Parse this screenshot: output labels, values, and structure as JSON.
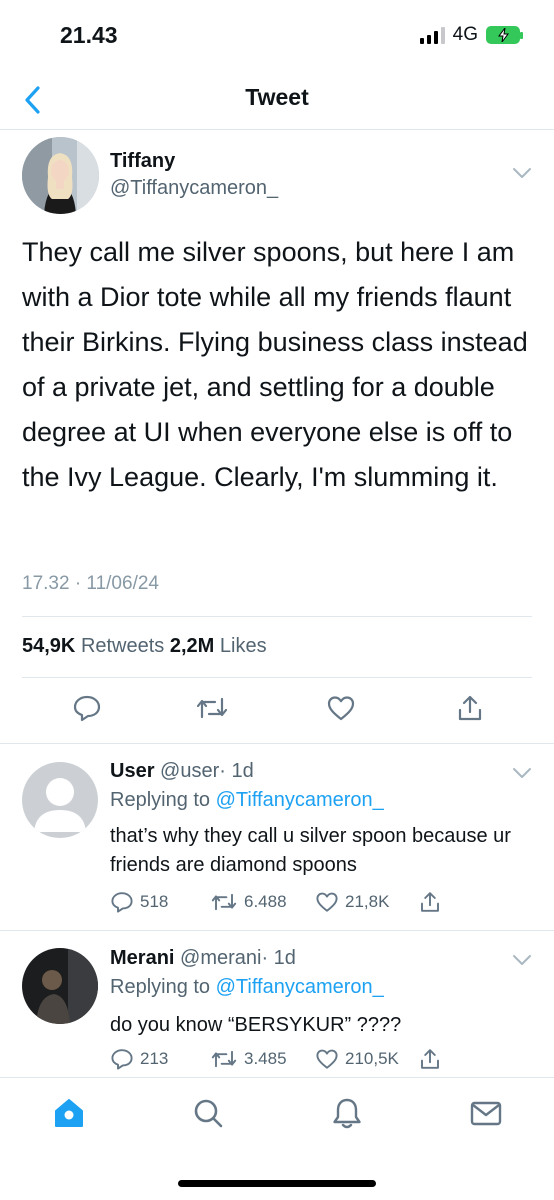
{
  "status_bar": {
    "time": "21.43",
    "network": "4G"
  },
  "header": {
    "title": "Tweet"
  },
  "tweet": {
    "author_name": "Tiffany",
    "author_handle": "@Tiffanycameron_",
    "text": "They call me silver spoons, but here I am with a Dior tote while all my friends flaunt their Birkins. Flying business class instead of a private jet, and settling for a double degree at UI when everyone else is off to the Ivy League. Clearly, I'm slumming it.",
    "timestamp": "17.32 · 11/06/24",
    "retweets_count": "54,9K",
    "retweets_label": "Retweets",
    "likes_count": "2,2M",
    "likes_label": "Likes"
  },
  "replies": [
    {
      "name": "User",
      "handle": "@user",
      "time": "· 1d",
      "replying_prefix": "Replying to",
      "replying_handle": "@Tiffanycameron_",
      "text": "that’s why they call u silver spoon because ur friends are diamond spoons",
      "comments": "518",
      "retweets": "6.488",
      "likes": "21,8K"
    },
    {
      "name": "Merani",
      "handle": "@merani",
      "time": "· 1d",
      "replying_prefix": "Replying to",
      "replying_handle": "@Tiffanycameron_",
      "text": "do you know “BERSYKUR” ????",
      "comments": "213",
      "retweets": "3.485",
      "likes": "210,5K"
    }
  ],
  "colors": {
    "accent": "#1da1f2",
    "secondary_text": "#536471",
    "border": "#e1e8ed",
    "battery": "#34c759"
  },
  "icons": {
    "back": "chevron-left-icon",
    "caret": "chevron-down-icon",
    "reply": "comment-icon",
    "retweet": "retweet-icon",
    "like": "heart-icon",
    "share": "share-icon",
    "tabs": [
      "home-icon",
      "search-icon",
      "bell-icon",
      "mail-icon"
    ]
  }
}
